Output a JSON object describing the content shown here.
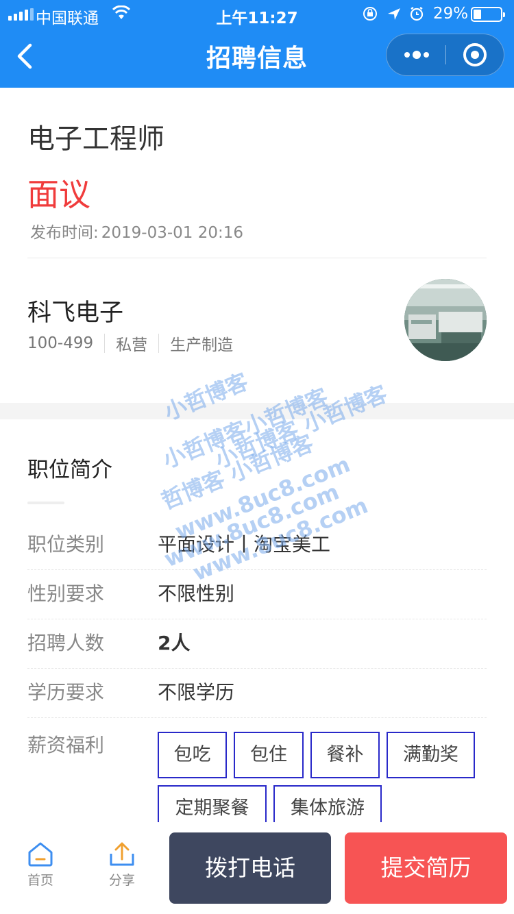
{
  "status_bar": {
    "carrier": "中国联通",
    "time": "上午11:27",
    "battery_pct": "29%",
    "battery_level": 0.29
  },
  "nav": {
    "title": "招聘信息",
    "back_icon": "chevron-left-icon",
    "more_icon": "more-dots-icon",
    "close_icon": "target-circle-icon"
  },
  "job": {
    "title": "电子工程师",
    "salary": "面议",
    "published_label": "发布时间:",
    "published_at": "2019-03-01 20:16"
  },
  "company": {
    "name": "科飞电子",
    "size": "100-499",
    "ownership": "私营",
    "industry": "生产制造"
  },
  "intro": {
    "title": "职位简介",
    "rows": [
      {
        "label": "职位类别",
        "value": "平面设计丨淘宝美工"
      },
      {
        "label": "性别要求",
        "value": "不限性别"
      },
      {
        "label": "招聘人数",
        "value": "2人"
      },
      {
        "label": "学历要求",
        "value": "不限学历"
      }
    ],
    "welfare_label": "薪资福利",
    "welfare_tags": [
      "包吃",
      "包住",
      "餐补",
      "满勤奖",
      "定期聚餐",
      "集体旅游"
    ]
  },
  "watermark": {
    "lines": [
      "小哲博客",
      "小哲博客小哲博客",
      "小哲博客 小哲博客",
      "哲博客 小哲博客",
      "www.8uc8.com",
      "www.8uc8.com",
      "www.8uc8.com"
    ]
  },
  "bottom_bar": {
    "home_label": "首页",
    "share_label": "分享",
    "call_label": "拨打电话",
    "submit_label": "提交简历"
  },
  "colors": {
    "primary": "#1f8cf5",
    "salary": "#f03c3c",
    "call_button": "#3e475f",
    "submit_button": "#f75454",
    "tag_border": "#2929c9"
  }
}
